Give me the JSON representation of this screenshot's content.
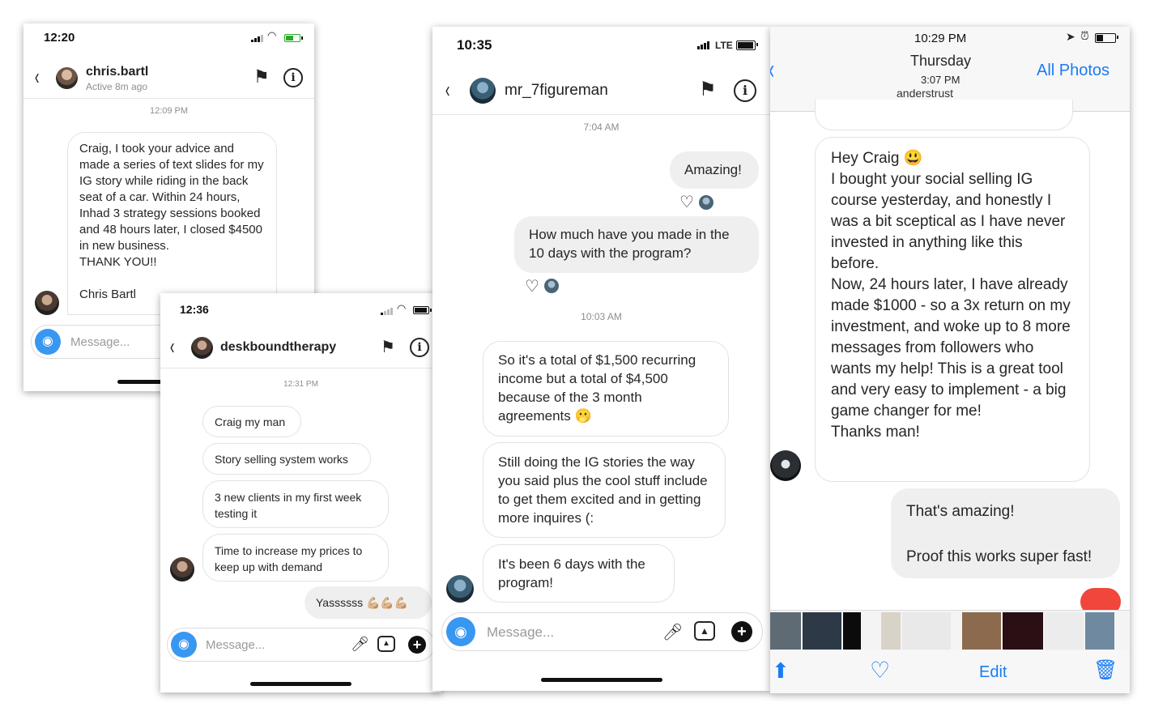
{
  "p1": {
    "time": "12:20",
    "username": "chris.bartl",
    "active": "Active 8m ago",
    "timestamp": "12:09 PM",
    "message": "Craig, I took your advice and made a series of text slides for my IG story while riding in the back seat of a car. Within 24 hours, Inhad 3 strategy sessions booked and 48 hours later, I closed $4500 in new business.\nTHANK YOU!!\n\nChris Bartl",
    "placeholder": "Message..."
  },
  "p2": {
    "time": "12:36",
    "username": "deskboundtherapy",
    "timestamp": "12:31 PM",
    "messages": [
      "Craig my man",
      "Story selling system works",
      "3 new clients in my first week testing it",
      "Time to increase my prices to keep up with demand"
    ],
    "reply": "Yassssss 💪🏼💪🏼💪🏼",
    "placeholder": "Message..."
  },
  "p3": {
    "time": "10:35",
    "network": "LTE",
    "username": "mr_7figureman",
    "timestamp1": "7:04 AM",
    "sent1": "Amazing!",
    "sent2": "How much have you made in the 10 days with the program?",
    "timestamp2": "10:03 AM",
    "recv1": "So it's a total of $1,500 recurring income but a total of $4,500 because of the 3 month agreements 🫢",
    "recv2": "Still doing the IG stories the way you said plus the cool stuff include to get them excited and in getting more inquires (:",
    "recv3": "It's been 6 days with the program!",
    "placeholder": "Message..."
  },
  "p4": {
    "time": "10:29 PM",
    "day": "Thursday",
    "subtime": "3:07 PM",
    "all_photos": "All Photos",
    "cut_top": "anderstrust",
    "message": "Hey Craig 😃\nI bought your social selling IG course yesterday, and honestly I was a bit sceptical as I have never invested in anything like this before.\nNow, 24 hours later, I have already made $1000 - so a 3x return on my investment, and woke up to 8 more messages from followers who wants my help! This is a great tool and very easy to implement - a big game changer for me!\nThanks man!",
    "reply": "That's amazing!\n\nProof this works super fast!",
    "edit": "Edit",
    "colors": {
      "accent": "#1a7cf5",
      "reaction": "#f0463c"
    }
  }
}
